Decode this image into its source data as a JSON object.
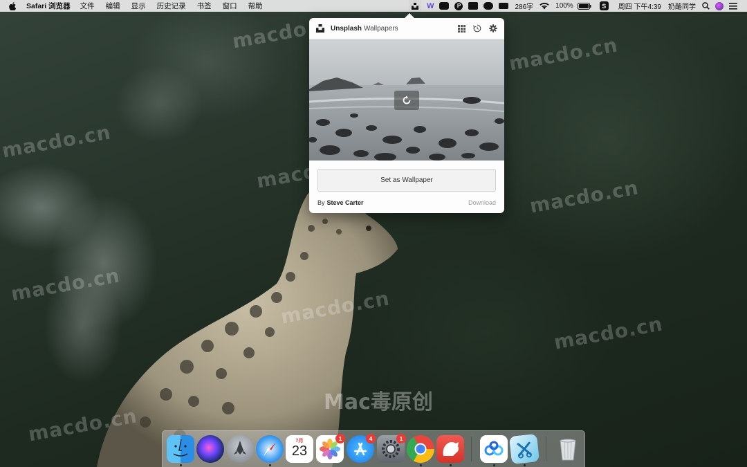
{
  "menubar": {
    "app_name": "Safari 浏览器",
    "menus": [
      "文件",
      "编辑",
      "显示",
      "历史记录",
      "书签",
      "窗口",
      "帮助"
    ],
    "word_count": "286字",
    "battery": "100%",
    "clock": "周四 下午4:39",
    "user": "奶酪同学",
    "tray_icons": [
      "unsplash-icon",
      "w-icon",
      "toggle-icon",
      "p-icon",
      "screen-icon",
      "cloud-icon",
      "stack-icon",
      "wifi-icon",
      "battery-icon",
      "s-icon",
      "search-icon",
      "siri-icon",
      "list-icon"
    ]
  },
  "popover": {
    "title": "Unsplash",
    "subtitle": "Wallpapers",
    "header_icons": [
      "grid-icon",
      "history-icon",
      "settings-icon"
    ],
    "set_wallpaper_label": "Set as Wallpaper",
    "by_prefix": "By",
    "author": "Steve Carter",
    "download_label": "Download"
  },
  "desktop": {
    "watermark": "macdo.cn",
    "center_mark": "Mac毒原创"
  },
  "dock": {
    "apps": [
      {
        "name": "finder-icon",
        "dot": true
      },
      {
        "name": "siri-icon",
        "dot": false
      },
      {
        "name": "launchpad-icon",
        "dot": false
      },
      {
        "name": "safari-icon",
        "dot": true
      },
      {
        "name": "calendar-icon",
        "dot": false,
        "month": "7月",
        "day": "23"
      },
      {
        "name": "photos-icon",
        "dot": false,
        "badge": "1"
      },
      {
        "name": "app-store-icon",
        "dot": false,
        "badge": "4"
      },
      {
        "name": "system-preferences-icon",
        "dot": false,
        "badge": "1"
      },
      {
        "name": "chrome-icon",
        "dot": true
      },
      {
        "name": "bear-icon",
        "dot": true
      },
      {
        "name": "baidu-netdisk-icon",
        "dot": true
      },
      {
        "name": "xcode-icon",
        "dot": true
      },
      {
        "name": "trash-icon",
        "dot": false
      }
    ]
  }
}
